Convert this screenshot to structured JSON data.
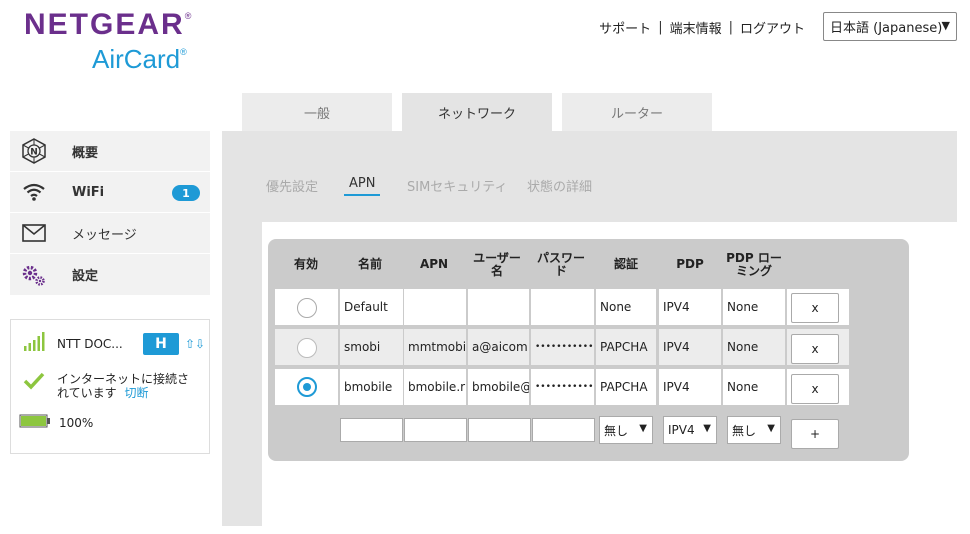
{
  "logo": {
    "brand": "NETGEAR",
    "product": "AirCard",
    "reg": "®"
  },
  "header": {
    "links": [
      "サポート",
      "端末情報",
      "ログアウト"
    ],
    "language": "日本語 (Japanese)"
  },
  "tabs": [
    {
      "label": "一般",
      "active": false
    },
    {
      "label": "ネットワーク",
      "active": true
    },
    {
      "label": "ルーター",
      "active": false
    }
  ],
  "sidebar": {
    "items": [
      {
        "label": "概要",
        "icon": "netgear-n-icon"
      },
      {
        "label": "WiFi",
        "icon": "wifi-icon",
        "badge": "1"
      },
      {
        "label": "メッセージ",
        "icon": "envelope-icon"
      },
      {
        "label": "設定",
        "icon": "gears-icon"
      }
    ]
  },
  "status": {
    "carrier": "NTT DOC...",
    "network_type": "H",
    "connection_text_1": "インターネットに接続さ",
    "connection_text_2": "れています",
    "disconnect_link": "切断",
    "battery": "100%",
    "battery_level": 1.0
  },
  "subtabs": [
    {
      "label": "優先設定",
      "active": false
    },
    {
      "label": "APN",
      "active": true
    },
    {
      "label": "SIMセキュリティ",
      "active": false
    },
    {
      "label": "状態の詳細",
      "active": false
    }
  ],
  "apn_table": {
    "headers": {
      "enabled": "有効",
      "name": "名前",
      "apn": "APN",
      "user_1": "ユーザー",
      "user_2": "名",
      "pass_1": "パスワー",
      "pass_2": "ド",
      "auth": "認証",
      "pdp": "PDP",
      "roam_1": "PDP ロー",
      "roam_2": "ミング"
    },
    "rows": [
      {
        "enabled": false,
        "name": "Default",
        "apn": "",
        "user": "",
        "password": "",
        "auth": "None",
        "pdp": "IPV4",
        "roaming": "None",
        "delete": "x"
      },
      {
        "enabled": false,
        "name": "smobi",
        "apn": "mmtmobi",
        "user": "a@aicom",
        "password": "•••••••••••",
        "auth": "PAPCHA",
        "pdp": "IPV4",
        "roaming": "None",
        "delete": "x"
      },
      {
        "enabled": true,
        "name": "bmobile",
        "apn": "bmobile.r",
        "user": "bmobile@",
        "password": "•••••••••••",
        "auth": "PAPCHA",
        "pdp": "IPV4",
        "roaming": "None",
        "delete": "x"
      }
    ],
    "new_row": {
      "auth": "無し",
      "pdp": "IPV4",
      "roaming": "無し",
      "add": "+"
    }
  },
  "colors": {
    "brand_purple": "#6b2f8c",
    "accent_blue": "#1e9ad6",
    "signal_green": "#8dc63f"
  }
}
